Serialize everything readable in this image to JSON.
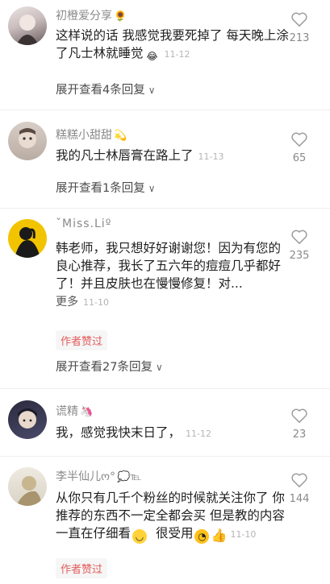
{
  "comments": [
    {
      "name": "初橙爱分享",
      "name_deco": "🌻",
      "text": "这样说的话  我感觉我要死掉了  每天晚上涂了凡士林就睡觉",
      "text_emoji": "😂",
      "time": "11-12",
      "likes": "213",
      "expand": "展开查看4条回复"
    },
    {
      "name": "糕糕小甜甜",
      "name_deco": "💫",
      "text": "我的凡士林唇膏在路上了",
      "time": "11-13",
      "likes": "65",
      "expand": "展开查看1条回复"
    },
    {
      "name": "ˇMiss.Liº",
      "text": "韩老师，我只想好好谢谢您！因为有您的良心推荐，我长了五六年的痘痘几乎都好了！并且皮肤也在慢慢修复！对...",
      "more": "更多",
      "time": "11-10",
      "likes": "235",
      "badge": "作者赞过",
      "expand": "展开查看27条回复"
    },
    {
      "name": "谎精",
      "name_deco": "🦄",
      "text": "我，感觉我快末日了，",
      "time": "11-12",
      "likes": "23"
    },
    {
      "name": "李半仙儿ო°",
      "name_deco": "💭℡",
      "text": "从你只有几千个粉丝的时候就关注你了 你推荐的东西不一定全都会买 但是教的内容一直在仔细看",
      "text_tail": "很受用",
      "time": "11-10",
      "likes": "144",
      "badge": "作者赞过"
    }
  ]
}
